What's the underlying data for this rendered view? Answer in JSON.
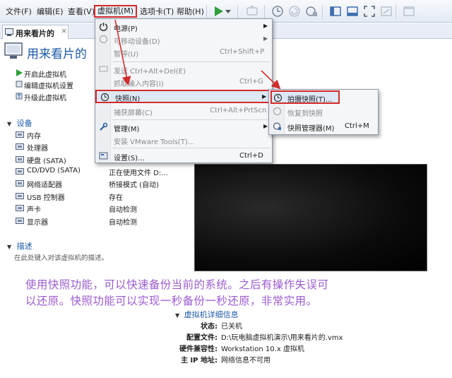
{
  "menubar": {
    "items": [
      "文件(F)",
      "编辑(E)",
      "查看(V)",
      "虚拟机(M)",
      "选项卡(T)",
      "帮助(H)"
    ]
  },
  "tab": {
    "label": "用来看片的",
    "close": "×"
  },
  "vm_title": "用来看片的",
  "actions": [
    "开启此虚拟机",
    "编辑虚拟机设置",
    "升级此虚拟机"
  ],
  "devices": {
    "heading": "设备",
    "rows": [
      {
        "name": "内存",
        "value": ""
      },
      {
        "name": "处理器",
        "value": ""
      },
      {
        "name": "硬盘 (SATA)",
        "value": ""
      },
      {
        "name": "CD/DVD (SATA)",
        "value": "正在使用文件 D:..."
      },
      {
        "name": "网络适配器",
        "value": "桥接模式 (自动)"
      },
      {
        "name": "USB 控制器",
        "value": "存在"
      },
      {
        "name": "声卡",
        "value": "自动检测"
      },
      {
        "name": "显示器",
        "value": "自动检测"
      }
    ]
  },
  "description": {
    "heading": "描述",
    "placeholder": "在此处键入对该虚拟机的描述。"
  },
  "vm_menu": {
    "items": [
      {
        "label": "电源(P)",
        "shortcut": "",
        "submenu": true,
        "disabled": false
      },
      {
        "label": "可移动设备(D)",
        "shortcut": "",
        "submenu": true,
        "disabled": true
      },
      {
        "label": "暂停(U)",
        "shortcut": "Ctrl+Shift+P",
        "submenu": false,
        "disabled": true
      },
      {
        "label": "发送 Ctrl+Alt+Del(E)",
        "shortcut": "",
        "submenu": false,
        "disabled": true
      },
      {
        "label": "抓取输入内容(I)",
        "shortcut": "Ctrl+G",
        "submenu": false,
        "disabled": true
      },
      {
        "label": "快照(N)",
        "shortcut": "",
        "submenu": true,
        "disabled": false
      },
      {
        "label": "捕获屏幕(C)",
        "shortcut": "Ctrl+Alt+PrtScn",
        "submenu": false,
        "disabled": true
      },
      {
        "label": "管理(M)",
        "shortcut": "",
        "submenu": true,
        "disabled": false
      },
      {
        "label": "安装 VMware Tools(T)...",
        "shortcut": "",
        "submenu": false,
        "disabled": true
      },
      {
        "label": "设置(S)...",
        "shortcut": "Ctrl+D",
        "submenu": false,
        "disabled": false
      }
    ]
  },
  "snapshot_menu": {
    "items": [
      {
        "label": "拍摄快照(T)...",
        "shortcut": "",
        "disabled": false
      },
      {
        "label": "恢复到快照",
        "shortcut": "",
        "disabled": true
      },
      {
        "label": "快照管理器(M)",
        "shortcut": "Ctrl+M",
        "disabled": false
      }
    ]
  },
  "caption": [
    "使用快照功能，可以快速备份当前的系统。之后有操作失误可",
    "以还原。快照功能可以实现一秒备份一秒还原，非常实用。"
  ],
  "details": {
    "heading": "虚拟机详细信息",
    "rows": [
      {
        "label": "状态:",
        "value": "已关机"
      },
      {
        "label": "配置文件:",
        "value": "D:\\玩电脑虚拟机演示\\用来看片的.vmx"
      },
      {
        "label": "硬件兼容性:",
        "value": "Workstation 10.x 虚拟机"
      },
      {
        "label": "主 IP 地址:",
        "value": "网络信息不可用"
      }
    ]
  },
  "colors": {
    "accent": "#1d5aa8",
    "highlight": "#d42b2b",
    "caption": "#9b5bd1",
    "play": "#2e9e3a"
  }
}
